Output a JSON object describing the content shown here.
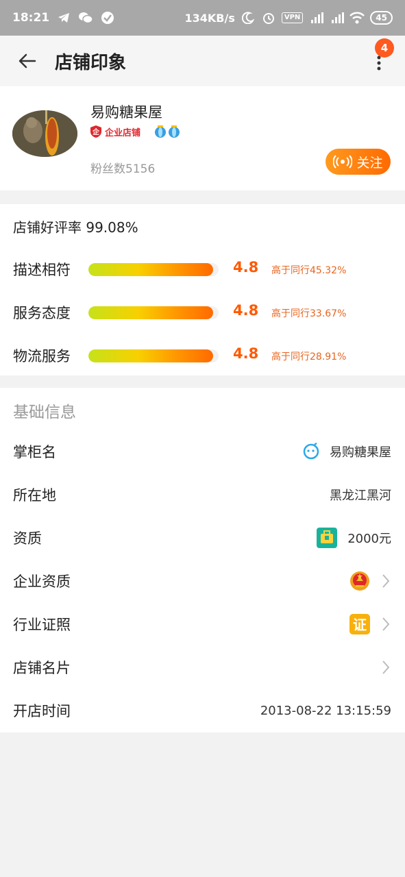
{
  "status_bar": {
    "time": "18:21",
    "net_speed": "134KB/s",
    "vpn": "VPN",
    "battery": "45"
  },
  "appbar": {
    "title": "店铺印象",
    "notification_count": "4"
  },
  "shop": {
    "name": "易购糖果屋",
    "enterprise_tag": "企业店铺",
    "fans": "粉丝数5156",
    "follow_label": "关注"
  },
  "rating": {
    "title": "店铺好评率 99.08%",
    "rows": [
      {
        "label": "描述相符",
        "score": "4.8",
        "compare": "高于同行45.32%",
        "fill": 0.96
      },
      {
        "label": "服务态度",
        "score": "4.8",
        "compare": "高于同行33.67%",
        "fill": 0.96
      },
      {
        "label": "物流服务",
        "score": "4.8",
        "compare": "高于同行28.91%",
        "fill": 0.96
      }
    ]
  },
  "basic_info": {
    "header": "基础信息",
    "rows": [
      {
        "label": "掌柜名",
        "value": "易购糖果屋",
        "icon": "wangwang-icon"
      },
      {
        "label": "所在地",
        "value": "黑龙江黑河"
      },
      {
        "label": "资质",
        "value": "2000元",
        "icon": "deposit-icon"
      },
      {
        "label": "企业资质",
        "value": "",
        "icon": "national-emblem-icon"
      },
      {
        "label": "行业证照",
        "value": "",
        "icon": "license-icon",
        "icon_text": "证"
      },
      {
        "label": "店铺名片",
        "value": ""
      },
      {
        "label": "开店时间",
        "value": "2013-08-22 13:15:59"
      }
    ]
  },
  "colors": {
    "accent": "#ff6a00",
    "score": "#ff5a00",
    "badge": "#ff5a1f"
  }
}
